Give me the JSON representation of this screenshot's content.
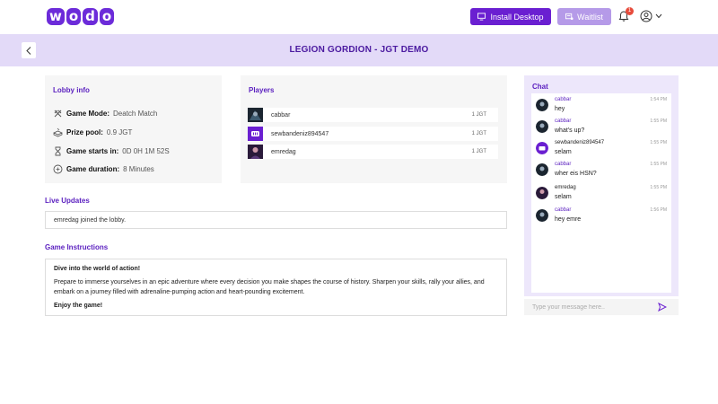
{
  "brand": {
    "logo_letters": [
      "w",
      "o",
      "d",
      "o"
    ],
    "color": "#6c2bd9"
  },
  "nav": {
    "install_label": "Install Desktop",
    "waitlist_label": "Waitlist",
    "notifications_count": "1"
  },
  "header": {
    "title": "LEGION GORDION - JGT DEMO"
  },
  "lobby": {
    "title": "Lobby info",
    "rows": [
      {
        "icon": "game-mode-icon",
        "label": "Game Mode:",
        "value": "Deatch Match"
      },
      {
        "icon": "prize-pool-icon",
        "label": "Prize pool:",
        "value": "0.9 JGT"
      },
      {
        "icon": "hourglass-icon",
        "label": "Game starts in:",
        "value": "0D 0H 1M 52S"
      },
      {
        "icon": "gamepad-icon",
        "label": "Game duration:",
        "value": "8 Minutes"
      }
    ]
  },
  "players": {
    "title": "Players",
    "list": [
      {
        "name": "cabbar",
        "amount": "1 JGT",
        "avatar": "cabbar-avatar"
      },
      {
        "name": "sewbandeniz894547",
        "amount": "1 JGT",
        "avatar": "wodo-avatar"
      },
      {
        "name": "emredag",
        "amount": "1 JGT",
        "avatar": "emredag-avatar"
      }
    ]
  },
  "live_updates": {
    "title": "Live Updates",
    "text": "emredag joined the lobby."
  },
  "instructions": {
    "title": "Game Instructions",
    "heading": "Dive into the world of action!",
    "body": "Prepare to immerse yourselves in an epic adventure where every decision you make shapes the course of history. Sharpen your skills, rally your allies, and embark on a journey filled with adrenaline-pumping action and heart-pounding excitement.",
    "ending": "Enjoy the game!"
  },
  "chat": {
    "title": "Chat",
    "placeholder": "Type your message here..",
    "messages": [
      {
        "user": "cabbar",
        "time": "1:54 PM",
        "text": "hey",
        "avatar": "cabbar-avatar"
      },
      {
        "user": "cabbar",
        "time": "1:55 PM",
        "text": "what's up?",
        "avatar": "cabbar-avatar"
      },
      {
        "user": "sewbandeniz894547",
        "time": "1:55 PM",
        "text": "selam",
        "avatar": "wodo-avatar"
      },
      {
        "user": "cabbar",
        "time": "1:55 PM",
        "text": "wher eis HSN?",
        "avatar": "cabbar-avatar"
      },
      {
        "user": "emredag",
        "time": "1:55 PM",
        "text": "selam",
        "avatar": "emredag-avatar"
      },
      {
        "user": "cabbar",
        "time": "1:56 PM",
        "text": "hey emre",
        "avatar": "cabbar-avatar"
      }
    ]
  },
  "colors": {
    "accent": "#6a1fd1",
    "accent_light": "#b59ae8",
    "header_bg": "#e3daf8",
    "chat_bg": "#ede7fb"
  }
}
